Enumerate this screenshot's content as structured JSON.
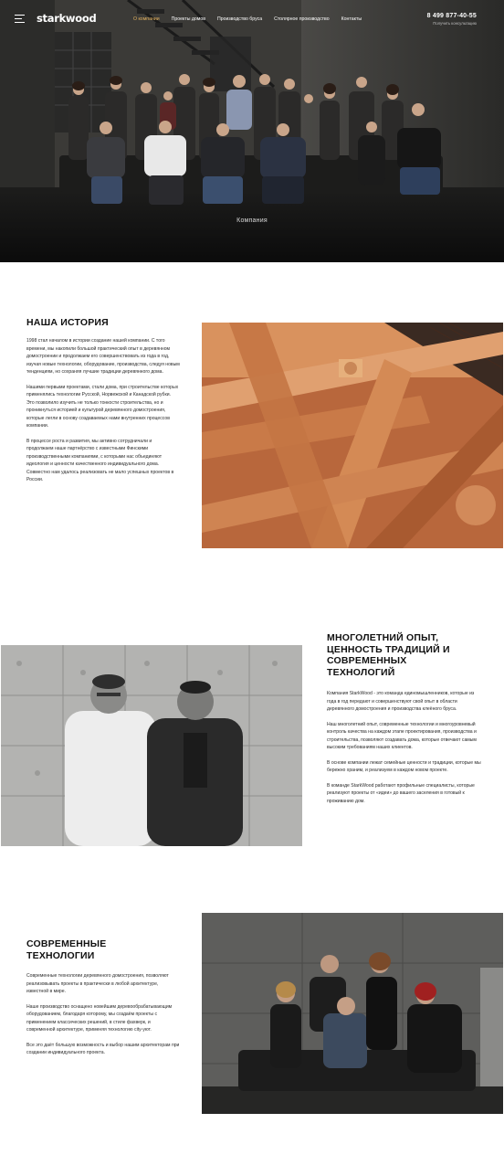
{
  "header": {
    "logo": "starkwood",
    "nav": [
      {
        "label": "О компании",
        "active": true
      },
      {
        "label": "Проекты домов",
        "active": false
      },
      {
        "label": "Производство бруса",
        "active": false
      },
      {
        "label": "Столярное производство",
        "active": false
      },
      {
        "label": "Контакты",
        "active": false
      }
    ],
    "phone": "8 499 877-40-55",
    "consult": "Получить консультацию",
    "menu_icon": "hamburger-icon"
  },
  "hero": {
    "caption": "Компания"
  },
  "history": {
    "title": "НАША ИСТОРИЯ",
    "paragraphs": [
      "1998 стал началом в истории создание нашей компании. С того времени, мы накопили большой практический опыт в деревянном домостроении и продолжаем его совершенствовать из года в год, изучая новые технологии, оборудование, производства, следуя новым тенденциям, но сохраняя лучшие традиции деревянного дома.",
      "Нашими первыми проектами, стали дома, при строительстве которых применялись технологии Русской, Норвежской и Канадской рубки. Это позволило изучить не только тонкости строительства, но и проникнуться историей и культурой деревянного домостроения, которые легли в основу создаваемых нами внутренних процессов компании.",
      "В процессе роста и развития, мы активно сотрудничали и продолжаем наше партнёрство с известными Финскими производственными компаниями, с которыми нас объединяют идеология и ценности качественного индивидуального дома. Совместно нам удалось реализовать не мало успешных проектов в России."
    ]
  },
  "experience": {
    "title": "МНОГОЛЕТНИЙ ОПЫТ, ЦЕННОСТЬ ТРАДИЦИЙ И СОВРЕМЕННЫХ ТЕХНОЛОГИЙ",
    "paragraphs": [
      "Компания StarkWood - это команда единомышленников, которые из года в год передают и совершенствуют свой опыт в области деревянного домостроения и производства клеёного бруса.",
      "Наш многолетний опыт, современные технологии и многоуровневый контроль качества на каждом этапе проектирования, производства и строительства, позволяют создавать дома, которые отвечают самым высоким требованиям наших клиентов.",
      "В основе компании лежат семейные ценности и традиции, которые мы бережно храним, и реализуем в каждом новом проекте.",
      "В команде StarkWood работают профильные специалисты, которые реализуют проекты от «идеи» до вашего заселения в готовый к проживанию дом."
    ]
  },
  "technology": {
    "title": "СОВРЕМЕННЫЕ ТЕХНОЛОГИИ",
    "paragraphs": [
      "Современные технологии деревянного домостроения, позволяют реализовывать проекты в практически в любой архитектуре, известной в мире.",
      "Наше производство оснащено новейшим деревообрабатывающим оборудованием, благодаря которому, мы создаём проекты с применением классических решений, в стиле фахверк, и современной архитектуре, применяя технологию city-уют.",
      "Все это даёт большую возможность и выбор нашим архитекторам при создании индивидуального проекта."
    ]
  },
  "colors": {
    "accent": "#e3b15f",
    "hero_bg": "#2a2a28",
    "text": "#1a1a1a",
    "wood": "#c9794a"
  }
}
